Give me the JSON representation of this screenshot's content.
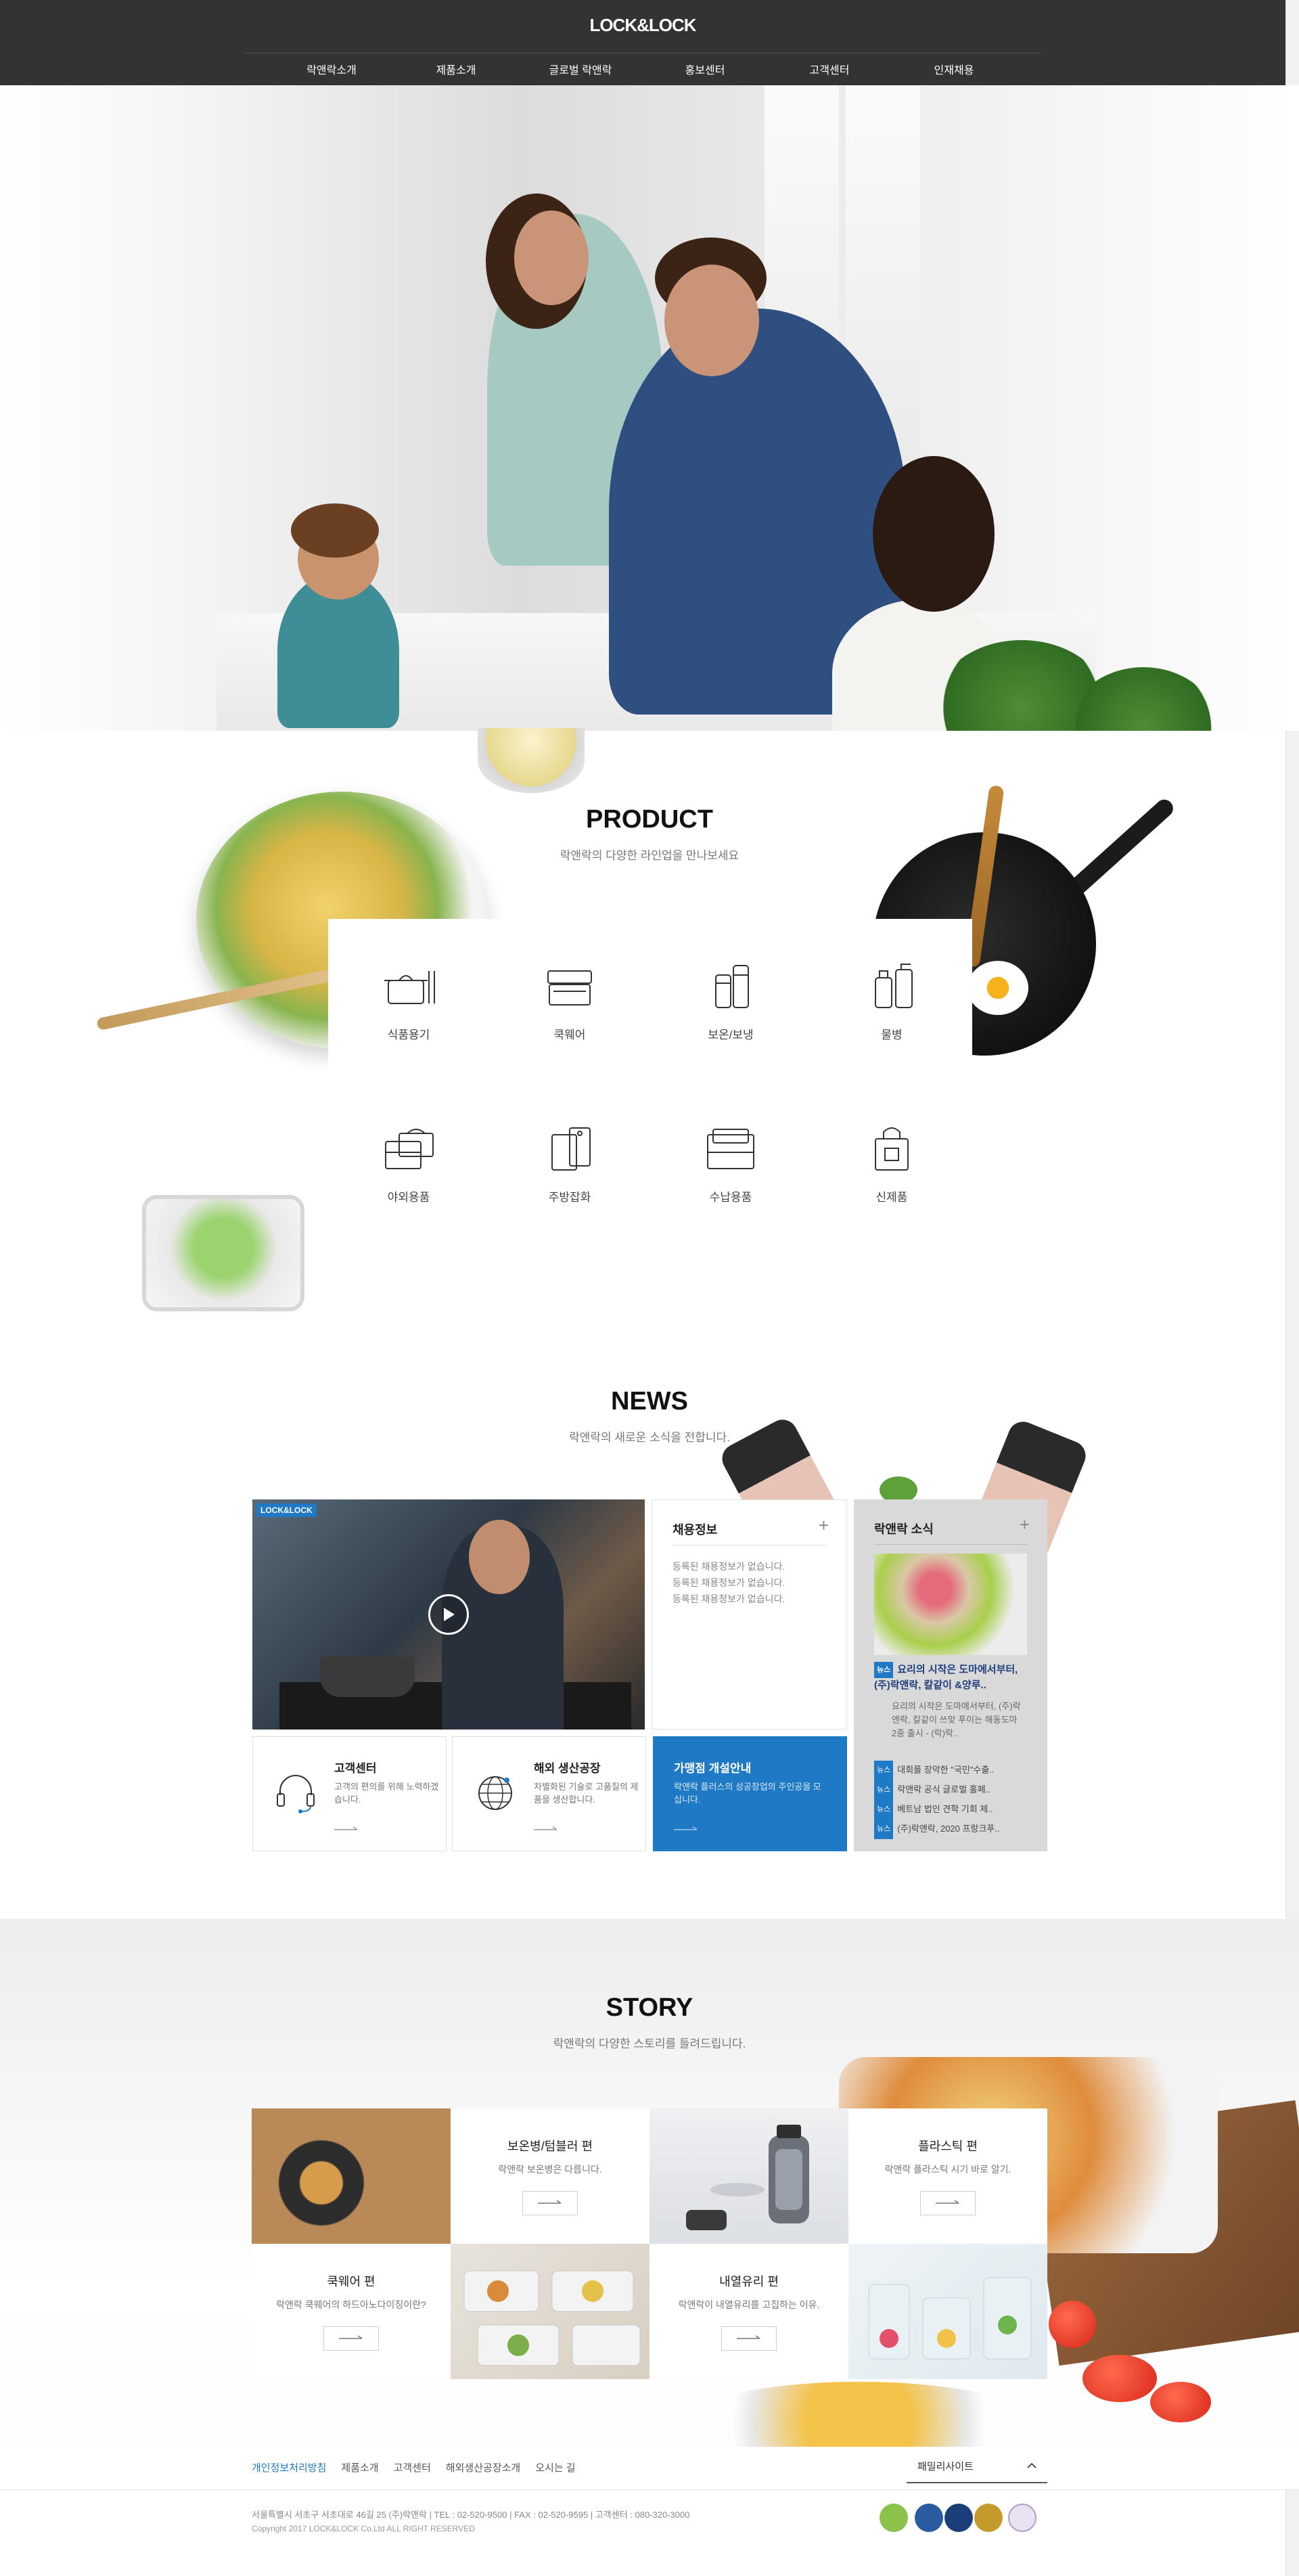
{
  "brand": {
    "logo": "LOCK&LOCK",
    "accent": "#1f79c4",
    "header_bg": "#333333"
  },
  "nav": {
    "items": [
      {
        "label": "락앤락소개"
      },
      {
        "label": "제품소개"
      },
      {
        "label": "글로벌 락앤락"
      },
      {
        "label": "홍보센터"
      },
      {
        "label": "고객센터"
      },
      {
        "label": "인재채용"
      }
    ]
  },
  "product": {
    "title": "PRODUCT",
    "subtitle": "락앤락의 다양한 라인업을 만나보세요",
    "items": [
      {
        "label": "식품용기",
        "icon": "pot-icon"
      },
      {
        "label": "쿡웨어",
        "icon": "container-icon"
      },
      {
        "label": "보온/보냉",
        "icon": "thermos-icon"
      },
      {
        "label": "물병",
        "icon": "bottle-icon"
      },
      {
        "label": "야외용품",
        "icon": "lunchbox-icon"
      },
      {
        "label": "주방잡화",
        "icon": "cutting-board-icon"
      },
      {
        "label": "수납용품",
        "icon": "storage-box-icon"
      },
      {
        "label": "신제품",
        "icon": "shopping-bag-icon"
      }
    ]
  },
  "news": {
    "title": "NEWS",
    "subtitle": "락앤락의 새로운 소식을 전합니다.",
    "video_logo": "LOCK&LOCK",
    "recruit": {
      "title": "채용정보",
      "items": [
        "등록된 채용정보가 없습니다.",
        "등록된 채용정보가 없습니다.",
        "등록된 채용정보가 없습니다."
      ]
    },
    "locknews": {
      "title": "락앤락 소식",
      "tag": "뉴스",
      "headline": "요리의 시작은 도마에서부터, (주)락앤락, 칼같이 &양루..",
      "desc": "요리의 시작은 도마에서부터, (주)락앤락, 칼같이 쓰맞 푸이는 해동도마 2종 출시 - (락)락..",
      "items": [
        "대회를 장악한 \"국민\"수출..",
        "락앤락 공식 글로벌 홀페..",
        "베트남 법인 견학 기회 제..",
        "(주)락앤락, 2020 프랑크푸.."
      ]
    },
    "cards": [
      {
        "title": "고객센터",
        "desc": "고객의 편의를 위해 노력하겠습니다.",
        "icon": "headset-icon"
      },
      {
        "title": "해외 생산공장",
        "desc": "차별화된 기술로 고품질의 제품을 생산합니다.",
        "icon": "globe-icon"
      },
      {
        "title": "가맹점 개설안내",
        "desc": "락앤락 플러스의 성공창업의 주인공을 모십니다."
      }
    ]
  },
  "story": {
    "title": "STORY",
    "subtitle": "락앤락의 다양한 스토리를 들려드립니다.",
    "cells": [
      {
        "title": "보온병/텀블러 편",
        "desc": "락앤락 보온병은 다릅니다."
      },
      {
        "title": "플라스틱 편",
        "desc": "락앤락 플라스틱 시기 바로 알기."
      },
      {
        "title": "쿡웨어 편",
        "desc": "락앤락 쿡웨어의 하드아노다이징이란?"
      },
      {
        "title": "내열유리 편",
        "desc": "락앤락이 내열유리를 고집하는 이유."
      }
    ]
  },
  "footer": {
    "links": [
      "개인정보처리방침",
      "제품소개",
      "고객센터",
      "해외생산공장소개",
      "오시는 길"
    ],
    "family_site": "패밀리사이트",
    "address": "서울특별시 서초구 서초대로 46길 25 (주)락앤락   |   TEL : 02-520-9500   |   FAX : 02-520-9595   |   고객센터 : 080-320-3000",
    "copyright": "Copyright 2017 LOCK&LOCK Co.Ltd ALL RIGHT RESERVED"
  }
}
